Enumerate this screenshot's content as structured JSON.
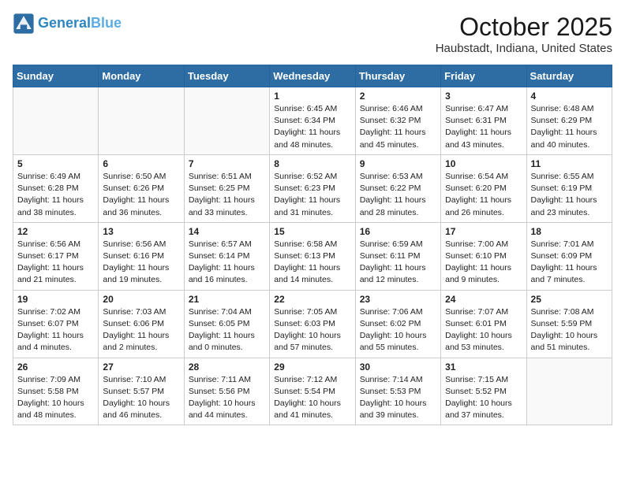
{
  "header": {
    "logo_line1": "General",
    "logo_line2": "Blue",
    "title": "October 2025",
    "subtitle": "Haubstadt, Indiana, United States"
  },
  "weekdays": [
    "Sunday",
    "Monday",
    "Tuesday",
    "Wednesday",
    "Thursday",
    "Friday",
    "Saturday"
  ],
  "weeks": [
    [
      {
        "day": "",
        "info": ""
      },
      {
        "day": "",
        "info": ""
      },
      {
        "day": "",
        "info": ""
      },
      {
        "day": "1",
        "info": "Sunrise: 6:45 AM\nSunset: 6:34 PM\nDaylight: 11 hours\nand 48 minutes."
      },
      {
        "day": "2",
        "info": "Sunrise: 6:46 AM\nSunset: 6:32 PM\nDaylight: 11 hours\nand 45 minutes."
      },
      {
        "day": "3",
        "info": "Sunrise: 6:47 AM\nSunset: 6:31 PM\nDaylight: 11 hours\nand 43 minutes."
      },
      {
        "day": "4",
        "info": "Sunrise: 6:48 AM\nSunset: 6:29 PM\nDaylight: 11 hours\nand 40 minutes."
      }
    ],
    [
      {
        "day": "5",
        "info": "Sunrise: 6:49 AM\nSunset: 6:28 PM\nDaylight: 11 hours\nand 38 minutes."
      },
      {
        "day": "6",
        "info": "Sunrise: 6:50 AM\nSunset: 6:26 PM\nDaylight: 11 hours\nand 36 minutes."
      },
      {
        "day": "7",
        "info": "Sunrise: 6:51 AM\nSunset: 6:25 PM\nDaylight: 11 hours\nand 33 minutes."
      },
      {
        "day": "8",
        "info": "Sunrise: 6:52 AM\nSunset: 6:23 PM\nDaylight: 11 hours\nand 31 minutes."
      },
      {
        "day": "9",
        "info": "Sunrise: 6:53 AM\nSunset: 6:22 PM\nDaylight: 11 hours\nand 28 minutes."
      },
      {
        "day": "10",
        "info": "Sunrise: 6:54 AM\nSunset: 6:20 PM\nDaylight: 11 hours\nand 26 minutes."
      },
      {
        "day": "11",
        "info": "Sunrise: 6:55 AM\nSunset: 6:19 PM\nDaylight: 11 hours\nand 23 minutes."
      }
    ],
    [
      {
        "day": "12",
        "info": "Sunrise: 6:56 AM\nSunset: 6:17 PM\nDaylight: 11 hours\nand 21 minutes."
      },
      {
        "day": "13",
        "info": "Sunrise: 6:56 AM\nSunset: 6:16 PM\nDaylight: 11 hours\nand 19 minutes."
      },
      {
        "day": "14",
        "info": "Sunrise: 6:57 AM\nSunset: 6:14 PM\nDaylight: 11 hours\nand 16 minutes."
      },
      {
        "day": "15",
        "info": "Sunrise: 6:58 AM\nSunset: 6:13 PM\nDaylight: 11 hours\nand 14 minutes."
      },
      {
        "day": "16",
        "info": "Sunrise: 6:59 AM\nSunset: 6:11 PM\nDaylight: 11 hours\nand 12 minutes."
      },
      {
        "day": "17",
        "info": "Sunrise: 7:00 AM\nSunset: 6:10 PM\nDaylight: 11 hours\nand 9 minutes."
      },
      {
        "day": "18",
        "info": "Sunrise: 7:01 AM\nSunset: 6:09 PM\nDaylight: 11 hours\nand 7 minutes."
      }
    ],
    [
      {
        "day": "19",
        "info": "Sunrise: 7:02 AM\nSunset: 6:07 PM\nDaylight: 11 hours\nand 4 minutes."
      },
      {
        "day": "20",
        "info": "Sunrise: 7:03 AM\nSunset: 6:06 PM\nDaylight: 11 hours\nand 2 minutes."
      },
      {
        "day": "21",
        "info": "Sunrise: 7:04 AM\nSunset: 6:05 PM\nDaylight: 11 hours\nand 0 minutes."
      },
      {
        "day": "22",
        "info": "Sunrise: 7:05 AM\nSunset: 6:03 PM\nDaylight: 10 hours\nand 57 minutes."
      },
      {
        "day": "23",
        "info": "Sunrise: 7:06 AM\nSunset: 6:02 PM\nDaylight: 10 hours\nand 55 minutes."
      },
      {
        "day": "24",
        "info": "Sunrise: 7:07 AM\nSunset: 6:01 PM\nDaylight: 10 hours\nand 53 minutes."
      },
      {
        "day": "25",
        "info": "Sunrise: 7:08 AM\nSunset: 5:59 PM\nDaylight: 10 hours\nand 51 minutes."
      }
    ],
    [
      {
        "day": "26",
        "info": "Sunrise: 7:09 AM\nSunset: 5:58 PM\nDaylight: 10 hours\nand 48 minutes."
      },
      {
        "day": "27",
        "info": "Sunrise: 7:10 AM\nSunset: 5:57 PM\nDaylight: 10 hours\nand 46 minutes."
      },
      {
        "day": "28",
        "info": "Sunrise: 7:11 AM\nSunset: 5:56 PM\nDaylight: 10 hours\nand 44 minutes."
      },
      {
        "day": "29",
        "info": "Sunrise: 7:12 AM\nSunset: 5:54 PM\nDaylight: 10 hours\nand 41 minutes."
      },
      {
        "day": "30",
        "info": "Sunrise: 7:14 AM\nSunset: 5:53 PM\nDaylight: 10 hours\nand 39 minutes."
      },
      {
        "day": "31",
        "info": "Sunrise: 7:15 AM\nSunset: 5:52 PM\nDaylight: 10 hours\nand 37 minutes."
      },
      {
        "day": "",
        "info": ""
      }
    ]
  ]
}
